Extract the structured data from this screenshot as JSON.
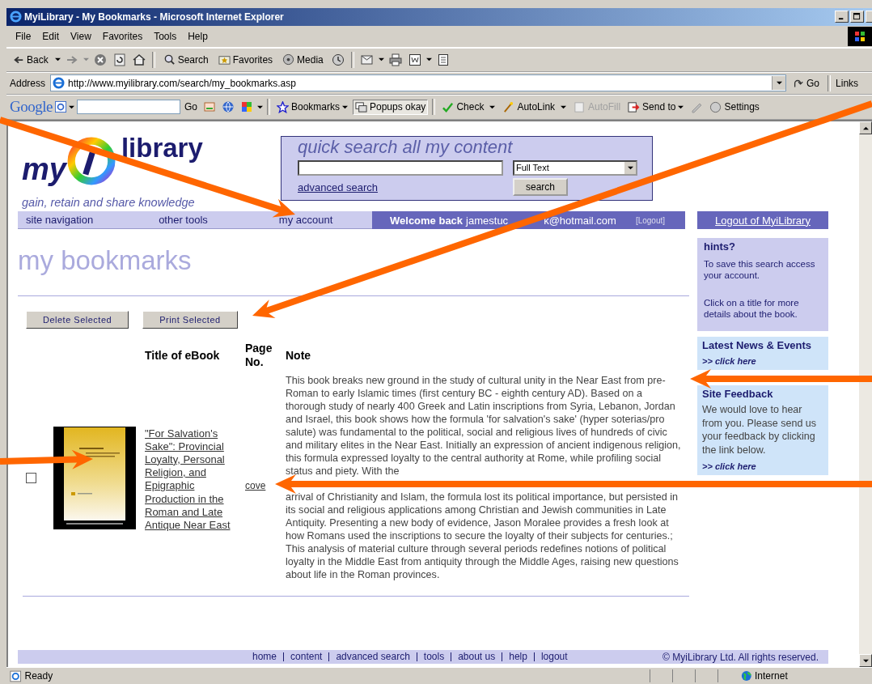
{
  "window": {
    "title": "MyiLibrary - My Bookmarks - Microsoft Internet Explorer"
  },
  "menu": [
    "File",
    "Edit",
    "View",
    "Favorites",
    "Tools",
    "Help"
  ],
  "toolbar": {
    "back": "Back",
    "search": "Search",
    "favorites": "Favorites",
    "media": "Media"
  },
  "address_bar": {
    "label": "Address",
    "url": "http://www.myilibrary.com/search/my_bookmarks.asp",
    "go": "Go",
    "links": "Links"
  },
  "google_bar": {
    "logo": "Google",
    "go": "Go",
    "items": [
      {
        "label": "Bookmarks",
        "disabled": false
      },
      {
        "label": "Popups okay",
        "disabled": false
      },
      {
        "label": "Check",
        "disabled": false
      },
      {
        "label": "AutoLink",
        "disabled": false
      },
      {
        "label": "AutoFill",
        "disabled": true
      },
      {
        "label": "Send to",
        "disabled": false
      },
      {
        "label": "Settings",
        "disabled": false
      }
    ]
  },
  "site": {
    "logo": {
      "word_1": "my",
      "word_2": "library",
      "tagline": "gain, retain and share knowledge"
    },
    "quick_search": {
      "title": "quick search all my content",
      "scope": "Full Text",
      "advanced_link": "advanced search",
      "button": "search"
    },
    "nav": {
      "items": [
        "site navigation",
        "other tools",
        "my account"
      ],
      "welcome": "Welcome back",
      "email_start": "jamestuc",
      "email_end": "k@hotmail.com",
      "logout_small": "[Logout]",
      "logout": "Logout of MyiLibrary"
    }
  },
  "page": {
    "heading": "my bookmarks",
    "buttons": [
      "Delete Selected",
      "Print Selected"
    ],
    "columns": [
      "Title of eBook",
      "Page No.",
      "Note"
    ],
    "rows": [
      {
        "checked": false,
        "title": "\"For Salvation's Sake\": Provincial Loyalty, Personal Religion, and Epigraphic Production in the Roman and Late Antique Near East",
        "page": "cove",
        "note": [
          "This book breaks new ground in the study of cultural unity in the Near East from pre-Roman to early Islamic times (first century BC - eighth century AD). Based on a thorough study of nearly 400 Greek and Latin inscriptions from Syria, Lebanon, Jordan and Israel, this book shows how the formula 'for salvation's sake' (hyper soterias/pro salute) was fundamental to the political, social and religious lives of hundreds of civic and military elites in the Near East. Initially an expression of ancient indigenous religion, this formula expressed loyalty to the central authority at Rome, while profiling social status and piety. With the",
          "arrival of Christianity and Islam, the formula lost its political importance, but persisted in its social and religious applications among Christian and Jewish communities in Late Antiquity. Presenting a new body of evidence, Jason Moralee provides a fresh look at how Romans used the inscriptions to secure the loyalty of their subjects for centuries.; This analysis of material culture through several periods redefines notions of political loyalty in the Middle East from antiquity through the Middle Ages, raising new questions about life in the Roman provinces."
        ]
      }
    ]
  },
  "sidebar": {
    "hints": {
      "title": "hints?",
      "paragraphs": [
        "To save this search access your account.",
        "Click on a title for more details about the book."
      ]
    },
    "news": {
      "title": "Latest News & Events",
      "link": ">> click here"
    },
    "feedback": {
      "title": "Site Feedback",
      "text": "We would love to hear from you. Please send us your feedback by clicking the link below.",
      "link": ">> click here"
    }
  },
  "footer": {
    "links": [
      "home",
      "content",
      "advanced search",
      "tools",
      "about us",
      "help",
      "logout"
    ],
    "copyright": "© MyiLibrary Ltd. All rights reserved."
  },
  "status_bar": {
    "text": "Ready",
    "zone": "Internet"
  }
}
